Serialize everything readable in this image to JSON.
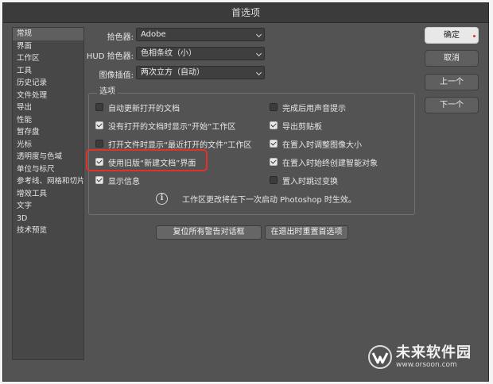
{
  "window": {
    "title": "首选项"
  },
  "sidebar": {
    "items": [
      {
        "label": "常规",
        "active": true
      },
      {
        "label": "界面"
      },
      {
        "label": "工作区"
      },
      {
        "label": "工具"
      },
      {
        "label": "历史记录"
      },
      {
        "label": "文件处理"
      },
      {
        "label": "导出"
      },
      {
        "label": "性能"
      },
      {
        "label": "暂存盘"
      },
      {
        "label": "光标"
      },
      {
        "label": "透明度与色域"
      },
      {
        "label": "单位与标尺"
      },
      {
        "label": "参考线、网格和切片"
      },
      {
        "label": "增效工具"
      },
      {
        "label": "文字"
      },
      {
        "label": "3D"
      },
      {
        "label": "技术预览"
      }
    ]
  },
  "fields": {
    "color_picker": {
      "label": "拾色器:",
      "value": "Adobe"
    },
    "hud_color_picker": {
      "label": "HUD 拾色器:",
      "value": "色相条纹（小）"
    },
    "image_interpolation": {
      "label": "图像插值:",
      "value": "两次立方（自动）"
    }
  },
  "options": {
    "title": "选项",
    "left": [
      {
        "label": "自动更新打开的文档",
        "checked": false
      },
      {
        "label": "没有打开的文档时显示“开始”工作区",
        "checked": true
      },
      {
        "label": "打开文件时显示“最近打开的文件”工作区",
        "checked": false
      },
      {
        "label": "使用旧版“新建文档”界面",
        "checked": true
      },
      {
        "label": "显示信息",
        "checked": true
      }
    ],
    "right": [
      {
        "label": "完成后用声音提示",
        "checked": false
      },
      {
        "label": "导出剪贴板",
        "checked": true
      },
      {
        "label": "在置入时调整图像大小",
        "checked": true
      },
      {
        "label": "在置入时始终创建智能对象",
        "checked": true
      },
      {
        "label": "置入时跳过变换",
        "checked": false
      }
    ],
    "info_text": "工作区更改将在下一次启动 Photoshop 时生效。"
  },
  "bottom_buttons": {
    "reset_warnings": "复位所有警告对话框",
    "reset_on_quit": "在退出时重置首选项"
  },
  "right_buttons": {
    "ok": "确定",
    "cancel": "取消",
    "prev": "上一个",
    "next": "下一个"
  },
  "watermark": {
    "title": "未来软件园",
    "url": "www.orsoon.com"
  },
  "colors": {
    "highlight": "#e1322a",
    "panel": "#535353",
    "accent_dot": "#e1322a"
  }
}
